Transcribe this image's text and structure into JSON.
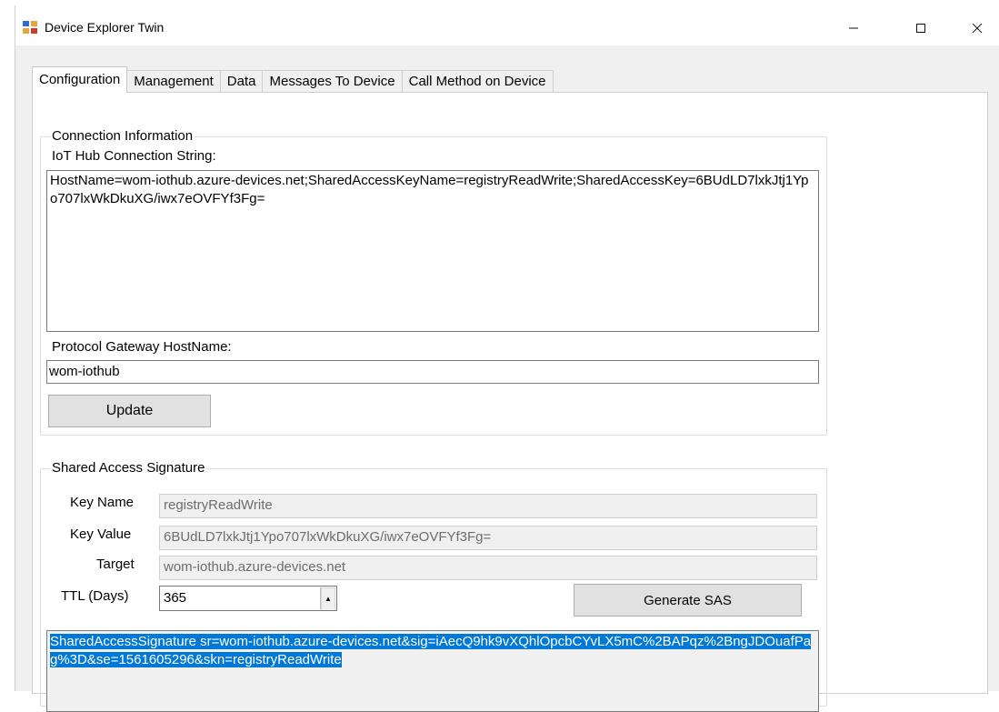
{
  "window": {
    "title": "Device Explorer Twin",
    "controls": {
      "minimize": "—",
      "maximize": "☐",
      "close": "✕"
    }
  },
  "tabs": [
    {
      "label": "Configuration",
      "active": true
    },
    {
      "label": "Management",
      "active": false
    },
    {
      "label": "Data",
      "active": false
    },
    {
      "label": "Messages To Device",
      "active": false
    },
    {
      "label": "Call Method on Device",
      "active": false
    }
  ],
  "connection": {
    "group_title": "Connection Information",
    "conn_string_label": "IoT Hub Connection String:",
    "conn_string_value": "HostName=wom-iothub.azure-devices.net;SharedAccessKeyName=registryReadWrite;SharedAccessKey=6BUdLD7lxkJtj1Ypo707lxWkDkuXG/iwx7eOVFYf3Fg=",
    "gateway_label": "Protocol Gateway HostName:",
    "gateway_value": "wom-iothub",
    "update_button": "Update"
  },
  "sas": {
    "group_title": "Shared Access Signature",
    "key_name_label": "Key Name",
    "key_name_value": "registryReadWrite",
    "key_value_label": "Key Value",
    "key_value_value": "6BUdLD7lxkJtj1Ypo707lxWkDkuXG/iwx7eOVFYf3Fg=",
    "target_label": "Target",
    "target_value": "wom-iothub.azure-devices.net",
    "ttl_label": "TTL (Days)",
    "ttl_value": "365",
    "generate_button": "Generate SAS",
    "output": "SharedAccessSignature sr=wom-iothub.azure-devices.net&sig=iAecQ9hk9vXQhlOpcbCYvLX5mC%2BAPqz%2BngJDOuafPag%3D&se=1561605296&skn=registryReadWrite"
  },
  "colors": {
    "selection": "#0078d7",
    "window_bg": "#f0f0f0",
    "panel_bg": "#ffffff"
  }
}
